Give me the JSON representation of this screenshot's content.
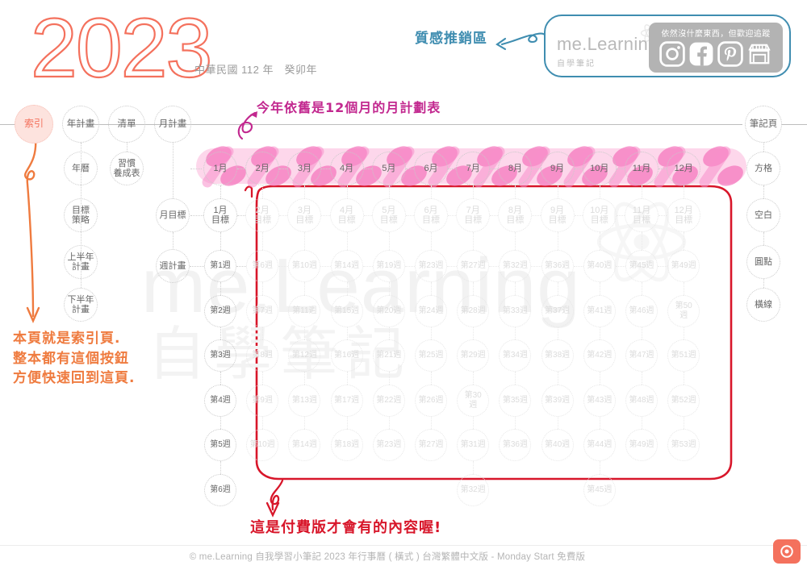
{
  "header": {
    "year": "2023",
    "subtitle": "中華民國 112 年　癸卯年"
  },
  "promo": {
    "brand_main": "me.Learning",
    "brand_sub": "自學筆記",
    "social_text": "依然沒什麼東西，但歡迎追蹤",
    "icons": [
      "instagram-icon",
      "facebook-icon",
      "pinterest-icon",
      "storefront-icon"
    ]
  },
  "watermark": {
    "line1": "me.Learning",
    "line2": "自學筆記"
  },
  "nav_left": {
    "index_label": "索引",
    "row_top": [
      "年計畫",
      "清單",
      "月計畫"
    ],
    "col_year": [
      "年曆",
      "目標\n策略",
      "上半年\n計畫",
      "下半年\n計畫"
    ],
    "col_list": [
      "習慣\n養成表"
    ],
    "col_month_labels": [
      "月目標",
      "週計畫"
    ]
  },
  "nav_right": {
    "items": [
      "筆記頁",
      "方格",
      "空白",
      "圓點",
      "橫線"
    ]
  },
  "months": {
    "labels": [
      "1月",
      "2月",
      "3月",
      "4月",
      "5月",
      "6月",
      "7月",
      "8月",
      "9月",
      "10月",
      "11月",
      "12月"
    ]
  },
  "month_goals": {
    "labels": [
      "1月\n目標",
      "2月\n目標",
      "3月\n目標",
      "4月\n目標",
      "5月\n目標",
      "6月\n目標",
      "7月\n目標",
      "8月\n目標",
      "9月\n目標",
      "10月\n目標",
      "11月\n目標",
      "12月\n目標"
    ]
  },
  "weeks": {
    "columns": [
      [
        "第1週",
        "第2週",
        "第3週",
        "第4週",
        "第5週",
        "第6週"
      ],
      [
        "第6週",
        "第7週",
        "第8週",
        "第9週",
        "第10週",
        ""
      ],
      [
        "第10週",
        "第11週",
        "第12週",
        "第13週",
        "第14週",
        ""
      ],
      [
        "第14週",
        "第15週",
        "第16週",
        "第17週",
        "第18週",
        ""
      ],
      [
        "第19週",
        "第20週",
        "第21週",
        "第22週",
        "第23週",
        ""
      ],
      [
        "第23週",
        "第24週",
        "第25週",
        "第26週",
        "第27週",
        ""
      ],
      [
        "第27週",
        "第28週",
        "第29週",
        "第30\n週",
        "第31週",
        "第32週"
      ],
      [
        "第32週",
        "第33週",
        "第34週",
        "第35週",
        "第36週",
        ""
      ],
      [
        "第36週",
        "第37週",
        "第38週",
        "第39週",
        "第40週",
        ""
      ],
      [
        "第40週",
        "第41週",
        "第42週",
        "第43週",
        "第44週",
        "第45週"
      ],
      [
        "第45週",
        "第46週",
        "第47週",
        "第48週",
        "第49週",
        ""
      ],
      [
        "第49週",
        "第50\n週",
        "第51週",
        "第52週",
        "第53週",
        ""
      ]
    ]
  },
  "annotations": {
    "purple": "今年依舊是12個月的月計劃表",
    "teal": "質感推銷區",
    "orange": "本頁就是索引頁.\n整本都有這個按鈕\n方便快速回到這頁.",
    "red": "這是付費版才會有的內容喔!"
  },
  "footer": {
    "text": "© me.Learning 自我學習小筆記 2023 年行事曆 ( 橫式 ) 台灣繁體中文版 - Monday Start 免費版",
    "corner_icon": "target-icon"
  },
  "colors": {
    "accent": "#f4715d",
    "highlight": "#f9a8d4",
    "purple": "#c2288f",
    "teal": "#3f8db0",
    "orange": "#ef7b3f",
    "red": "#d8162a"
  }
}
